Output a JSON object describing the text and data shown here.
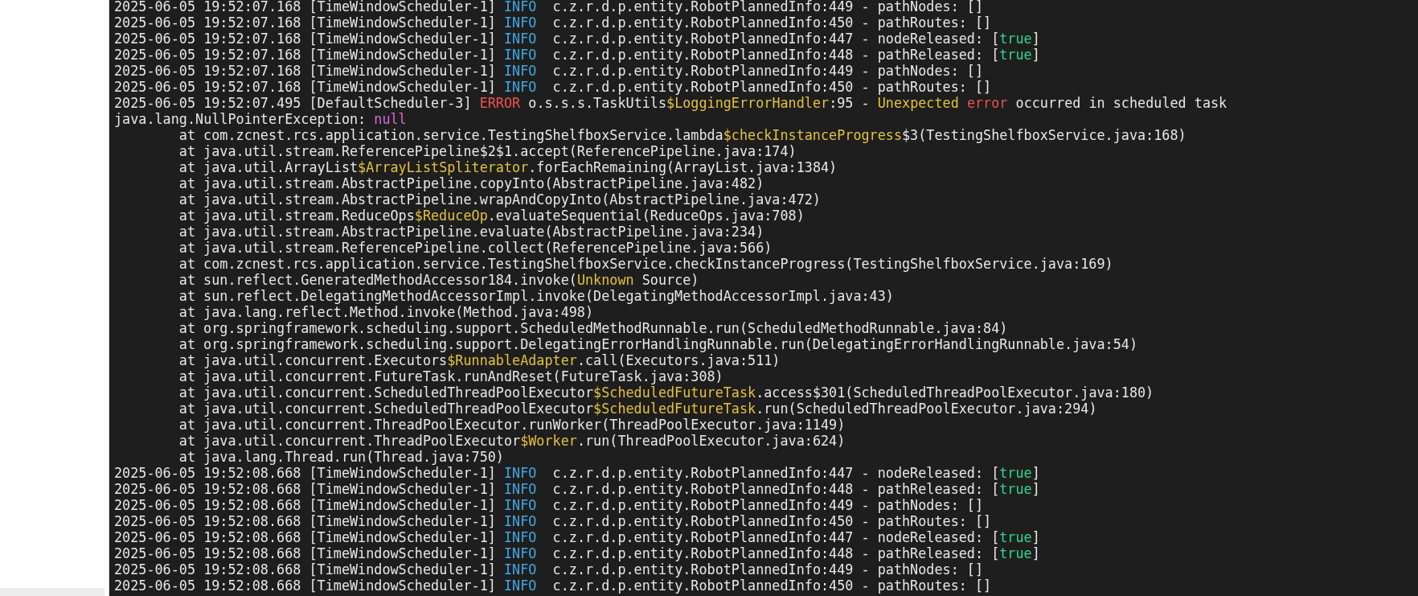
{
  "log": {
    "lines": [
      {
        "kind": "entry",
        "segments": [
          {
            "kind": "plain",
            "text": "2025-06-05 19:52:07.168 [TimeWindowScheduler-1] "
          },
          {
            "kind": "info",
            "text": "INFO"
          },
          {
            "kind": "plain",
            "text": "  c.z.r.d.p.entity.RobotPlannedInfo:449 - pathNodes: []"
          }
        ]
      },
      {
        "kind": "entry",
        "segments": [
          {
            "kind": "plain",
            "text": "2025-06-05 19:52:07.168 [TimeWindowScheduler-1] "
          },
          {
            "kind": "info",
            "text": "INFO"
          },
          {
            "kind": "plain",
            "text": "  c.z.r.d.p.entity.RobotPlannedInfo:450 - pathRoutes: []"
          }
        ]
      },
      {
        "kind": "entry",
        "segments": [
          {
            "kind": "plain",
            "text": "2025-06-05 19:52:07.168 [TimeWindowScheduler-1] "
          },
          {
            "kind": "info",
            "text": "INFO"
          },
          {
            "kind": "plain",
            "text": "  c.z.r.d.p.entity.RobotPlannedInfo:447 - nodeReleased: ["
          },
          {
            "kind": "boolean",
            "text": "true"
          },
          {
            "kind": "plain",
            "text": "]"
          }
        ]
      },
      {
        "kind": "entry",
        "segments": [
          {
            "kind": "plain",
            "text": "2025-06-05 19:52:07.168 [TimeWindowScheduler-1] "
          },
          {
            "kind": "info",
            "text": "INFO"
          },
          {
            "kind": "plain",
            "text": "  c.z.r.d.p.entity.RobotPlannedInfo:448 - pathReleased: ["
          },
          {
            "kind": "boolean",
            "text": "true"
          },
          {
            "kind": "plain",
            "text": "]"
          }
        ]
      },
      {
        "kind": "entry",
        "segments": [
          {
            "kind": "plain",
            "text": "2025-06-05 19:52:07.168 [TimeWindowScheduler-1] "
          },
          {
            "kind": "info",
            "text": "INFO"
          },
          {
            "kind": "plain",
            "text": "  c.z.r.d.p.entity.RobotPlannedInfo:449 - pathNodes: []"
          }
        ]
      },
      {
        "kind": "entry",
        "segments": [
          {
            "kind": "plain",
            "text": "2025-06-05 19:52:07.168 [TimeWindowScheduler-1] "
          },
          {
            "kind": "info",
            "text": "INFO"
          },
          {
            "kind": "plain",
            "text": "  c.z.r.d.p.entity.RobotPlannedInfo:450 - pathRoutes: []"
          }
        ]
      },
      {
        "kind": "entry",
        "segments": [
          {
            "kind": "plain",
            "text": "2025-06-05 19:52:07.495 [DefaultScheduler-3] "
          },
          {
            "kind": "error",
            "text": "ERROR"
          },
          {
            "kind": "plain",
            "text": " o.s.s.s.TaskUtils"
          },
          {
            "kind": "highlight",
            "text": "$LoggingErrorHandler"
          },
          {
            "kind": "plain",
            "text": ":95 - "
          },
          {
            "kind": "highlight",
            "text": "Unexpected "
          },
          {
            "kind": "error",
            "text": "error"
          },
          {
            "kind": "plain",
            "text": " occurred in scheduled task"
          }
        ]
      },
      {
        "kind": "entry",
        "segments": [
          {
            "kind": "plain",
            "text": "java.lang.NullPointerException: "
          },
          {
            "kind": "null",
            "text": "null"
          }
        ]
      },
      {
        "kind": "frame",
        "segments": [
          {
            "kind": "plain",
            "text": "at com.zcnest.rcs.application.service.TestingShelfboxService.lambda"
          },
          {
            "kind": "highlight",
            "text": "$checkInstanceProgress"
          },
          {
            "kind": "plain",
            "text": "$3(TestingShelfboxService.java:168)"
          }
        ]
      },
      {
        "kind": "frame",
        "segments": [
          {
            "kind": "plain",
            "text": "at java.util.stream.ReferencePipeline$2$1.accept(ReferencePipeline.java:174)"
          }
        ]
      },
      {
        "kind": "frame",
        "segments": [
          {
            "kind": "plain",
            "text": "at java.util.ArrayList"
          },
          {
            "kind": "highlight",
            "text": "$ArrayListSpliterator"
          },
          {
            "kind": "plain",
            "text": ".forEachRemaining(ArrayList.java:1384)"
          }
        ]
      },
      {
        "kind": "frame",
        "segments": [
          {
            "kind": "plain",
            "text": "at java.util.stream.AbstractPipeline.copyInto(AbstractPipeline.java:482)"
          }
        ]
      },
      {
        "kind": "frame",
        "segments": [
          {
            "kind": "plain",
            "text": "at java.util.stream.AbstractPipeline.wrapAndCopyInto(AbstractPipeline.java:472)"
          }
        ]
      },
      {
        "kind": "frame",
        "segments": [
          {
            "kind": "plain",
            "text": "at java.util.stream.ReduceOps"
          },
          {
            "kind": "highlight",
            "text": "$ReduceOp"
          },
          {
            "kind": "plain",
            "text": ".evaluateSequential(ReduceOps.java:708)"
          }
        ]
      },
      {
        "kind": "frame",
        "segments": [
          {
            "kind": "plain",
            "text": "at java.util.stream.AbstractPipeline.evaluate(AbstractPipeline.java:234)"
          }
        ]
      },
      {
        "kind": "frame",
        "segments": [
          {
            "kind": "plain",
            "text": "at java.util.stream.ReferencePipeline.collect(ReferencePipeline.java:566)"
          }
        ]
      },
      {
        "kind": "frame",
        "segments": [
          {
            "kind": "plain",
            "text": "at com.zcnest.rcs.application.service.TestingShelfboxService.checkInstanceProgress(TestingShelfboxService.java:169)"
          }
        ]
      },
      {
        "kind": "frame",
        "segments": [
          {
            "kind": "plain",
            "text": "at sun.reflect.GeneratedMethodAccessor184.invoke("
          },
          {
            "kind": "highlight",
            "text": "Unknown"
          },
          {
            "kind": "plain",
            "text": " Source)"
          }
        ]
      },
      {
        "kind": "frame",
        "segments": [
          {
            "kind": "plain",
            "text": "at sun.reflect.DelegatingMethodAccessorImpl.invoke(DelegatingMethodAccessorImpl.java:43)"
          }
        ]
      },
      {
        "kind": "frame",
        "segments": [
          {
            "kind": "plain",
            "text": "at java.lang.reflect.Method.invoke(Method.java:498)"
          }
        ]
      },
      {
        "kind": "frame",
        "segments": [
          {
            "kind": "plain",
            "text": "at org.springframework.scheduling.support.ScheduledMethodRunnable.run(ScheduledMethodRunnable.java:84)"
          }
        ]
      },
      {
        "kind": "frame",
        "segments": [
          {
            "kind": "plain",
            "text": "at org.springframework.scheduling.support.DelegatingErrorHandlingRunnable.run(DelegatingErrorHandlingRunnable.java:54)"
          }
        ]
      },
      {
        "kind": "frame",
        "segments": [
          {
            "kind": "plain",
            "text": "at java.util.concurrent.Executors"
          },
          {
            "kind": "highlight",
            "text": "$RunnableAdapter"
          },
          {
            "kind": "plain",
            "text": ".call(Executors.java:511)"
          }
        ]
      },
      {
        "kind": "frame",
        "segments": [
          {
            "kind": "plain",
            "text": "at java.util.concurrent.FutureTask.runAndReset(FutureTask.java:308)"
          }
        ]
      },
      {
        "kind": "frame",
        "segments": [
          {
            "kind": "plain",
            "text": "at java.util.concurrent.ScheduledThreadPoolExecutor"
          },
          {
            "kind": "highlight",
            "text": "$ScheduledFutureTask"
          },
          {
            "kind": "plain",
            "text": ".access$301(ScheduledThreadPoolExecutor.java:180)"
          }
        ]
      },
      {
        "kind": "frame",
        "segments": [
          {
            "kind": "plain",
            "text": "at java.util.concurrent.ScheduledThreadPoolExecutor"
          },
          {
            "kind": "highlight",
            "text": "$ScheduledFutureTask"
          },
          {
            "kind": "plain",
            "text": ".run(ScheduledThreadPoolExecutor.java:294)"
          }
        ]
      },
      {
        "kind": "frame",
        "segments": [
          {
            "kind": "plain",
            "text": "at java.util.concurrent.ThreadPoolExecutor.runWorker(ThreadPoolExecutor.java:1149)"
          }
        ]
      },
      {
        "kind": "frame",
        "segments": [
          {
            "kind": "plain",
            "text": "at java.util.concurrent.ThreadPoolExecutor"
          },
          {
            "kind": "highlight",
            "text": "$Worker"
          },
          {
            "kind": "plain",
            "text": ".run(ThreadPoolExecutor.java:624)"
          }
        ]
      },
      {
        "kind": "frame",
        "segments": [
          {
            "kind": "plain",
            "text": "at java.lang.Thread.run(Thread.java:750)"
          }
        ]
      },
      {
        "kind": "entry",
        "segments": [
          {
            "kind": "plain",
            "text": "2025-06-05 19:52:08.668 [TimeWindowScheduler-1] "
          },
          {
            "kind": "info",
            "text": "INFO"
          },
          {
            "kind": "plain",
            "text": "  c.z.r.d.p.entity.RobotPlannedInfo:447 - nodeReleased: ["
          },
          {
            "kind": "boolean",
            "text": "true"
          },
          {
            "kind": "plain",
            "text": "]"
          }
        ]
      },
      {
        "kind": "entry",
        "segments": [
          {
            "kind": "plain",
            "text": "2025-06-05 19:52:08.668 [TimeWindowScheduler-1] "
          },
          {
            "kind": "info",
            "text": "INFO"
          },
          {
            "kind": "plain",
            "text": "  c.z.r.d.p.entity.RobotPlannedInfo:448 - pathReleased: ["
          },
          {
            "kind": "boolean",
            "text": "true"
          },
          {
            "kind": "plain",
            "text": "]"
          }
        ]
      },
      {
        "kind": "entry",
        "segments": [
          {
            "kind": "plain",
            "text": "2025-06-05 19:52:08.668 [TimeWindowScheduler-1] "
          },
          {
            "kind": "info",
            "text": "INFO"
          },
          {
            "kind": "plain",
            "text": "  c.z.r.d.p.entity.RobotPlannedInfo:449 - pathNodes: []"
          }
        ]
      },
      {
        "kind": "entry",
        "segments": [
          {
            "kind": "plain",
            "text": "2025-06-05 19:52:08.668 [TimeWindowScheduler-1] "
          },
          {
            "kind": "info",
            "text": "INFO"
          },
          {
            "kind": "plain",
            "text": "  c.z.r.d.p.entity.RobotPlannedInfo:450 - pathRoutes: []"
          }
        ]
      },
      {
        "kind": "entry",
        "segments": [
          {
            "kind": "plain",
            "text": "2025-06-05 19:52:08.668 [TimeWindowScheduler-1] "
          },
          {
            "kind": "info",
            "text": "INFO"
          },
          {
            "kind": "plain",
            "text": "  c.z.r.d.p.entity.RobotPlannedInfo:447 - nodeReleased: ["
          },
          {
            "kind": "boolean",
            "text": "true"
          },
          {
            "kind": "plain",
            "text": "]"
          }
        ]
      },
      {
        "kind": "entry",
        "segments": [
          {
            "kind": "plain",
            "text": "2025-06-05 19:52:08.668 [TimeWindowScheduler-1] "
          },
          {
            "kind": "info",
            "text": "INFO"
          },
          {
            "kind": "plain",
            "text": "  c.z.r.d.p.entity.RobotPlannedInfo:448 - pathReleased: ["
          },
          {
            "kind": "boolean",
            "text": "true"
          },
          {
            "kind": "plain",
            "text": "]"
          }
        ]
      },
      {
        "kind": "entry",
        "segments": [
          {
            "kind": "plain",
            "text": "2025-06-05 19:52:08.668 [TimeWindowScheduler-1] "
          },
          {
            "kind": "info",
            "text": "INFO"
          },
          {
            "kind": "plain",
            "text": "  c.z.r.d.p.entity.RobotPlannedInfo:449 - pathNodes: []"
          }
        ]
      },
      {
        "kind": "entry",
        "segments": [
          {
            "kind": "plain",
            "text": "2025-06-05 19:52:08.668 [TimeWindowScheduler-1] "
          },
          {
            "kind": "info",
            "text": "INFO"
          },
          {
            "kind": "plain",
            "text": "  c.z.r.d.p.entity.RobotPlannedInfo:450 - pathRoutes: []"
          }
        ]
      }
    ]
  }
}
